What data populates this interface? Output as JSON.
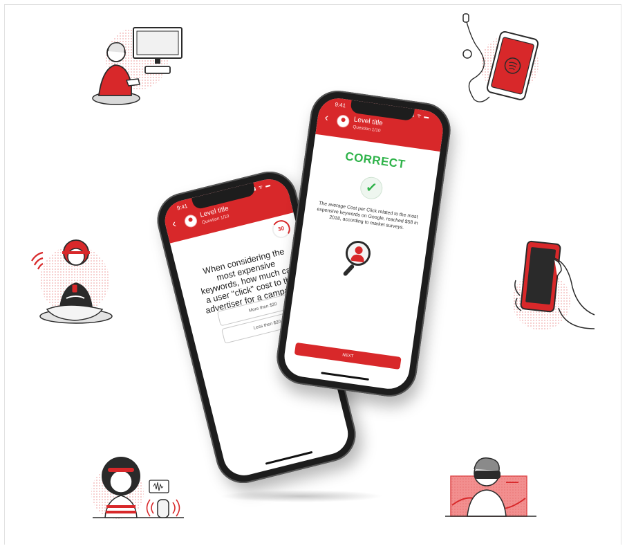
{
  "colors": {
    "accent": "#d8282a",
    "success": "#2fb34a",
    "ink": "#2a2a2a"
  },
  "phone_left": {
    "status_time": "9:41",
    "status_icons": "▮▮ ᯤ ▬",
    "level_title": "Level title",
    "level_subtitle": "Question 1/10",
    "timer": "30",
    "question": "When considering the most expensive keywords, how much can a user \"click\" cost to the advertiser for a campaign on",
    "answers": [
      "More then $20",
      "Less then $20"
    ]
  },
  "phone_right": {
    "status_time": "9:41",
    "status_icons": "▮▮ ᯤ ▬",
    "level_title": "Level title",
    "level_subtitle": "Question 1/10",
    "result": "CORRECT",
    "check_icon": "✓",
    "explanation": "The average Cost per Click related to the most expensive keywords on Google, reached $58 in 2018, according to market surveys.",
    "next_label": "NEXT"
  },
  "illustrations": {
    "top_left": "gamer-icon",
    "top_right": "music-phone-icon",
    "mid_left": "wifi-girl-icon",
    "mid_right": "hand-phone-icon",
    "bottom_left": "smart-speaker-icon",
    "bottom_right": "vr-user-icon"
  }
}
